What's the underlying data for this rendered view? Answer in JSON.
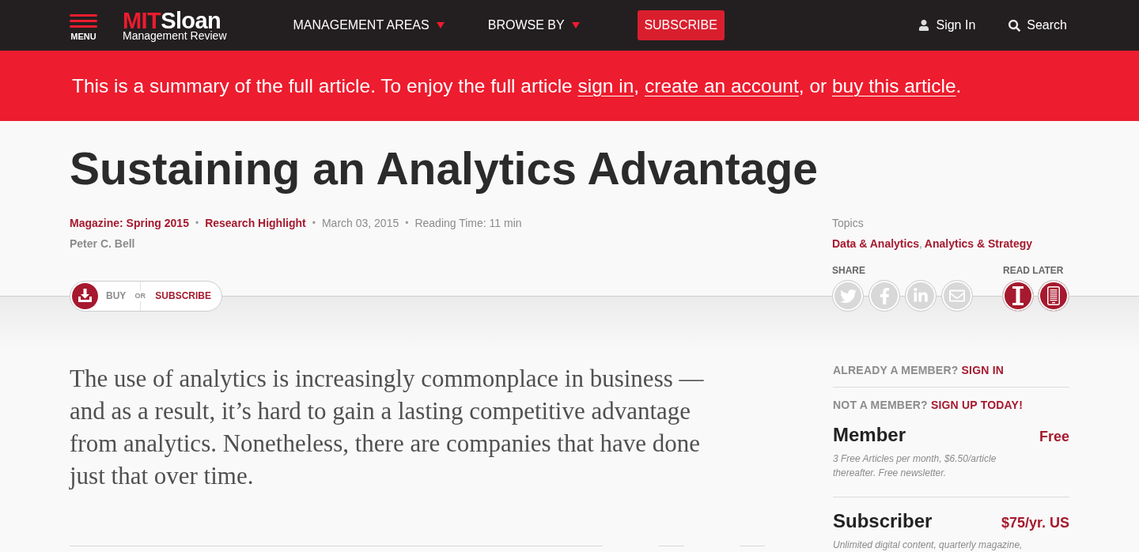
{
  "header": {
    "menu_label": "MENU",
    "logo": {
      "accent": "MIT",
      "name": "Sloan",
      "subtitle": "Management Review"
    },
    "nav_items": [
      {
        "label": "MANAGEMENT AREAS",
        "kind": "dropdown"
      },
      {
        "label": "BROWSE BY",
        "kind": "dropdown"
      },
      {
        "label": "SUBSCRIBE",
        "kind": "button"
      }
    ],
    "actions": [
      {
        "label": "Sign In",
        "kind": "account"
      },
      {
        "label": "Search",
        "kind": "search"
      }
    ]
  },
  "notice": {
    "segments": [
      {
        "text": "This is a summary of the full article. To enjoy the full article ",
        "kind": "text"
      },
      {
        "text": "sign in",
        "kind": "link"
      },
      {
        "text": ", ",
        "kind": "text"
      },
      {
        "text": "create an account",
        "kind": "link"
      },
      {
        "text": ", or ",
        "kind": "text"
      },
      {
        "text": "buy this article",
        "kind": "link"
      },
      {
        "text": ".",
        "kind": "text"
      }
    ]
  },
  "article": {
    "title": "Sustaining an Analytics Advantage",
    "meta": [
      {
        "text": "Magazine: Spring 2015",
        "kind": "link"
      },
      {
        "text": "Research Highlight",
        "kind": "link"
      },
      {
        "text": "March 03, 2015",
        "kind": "plain"
      },
      {
        "text": "Reading Time: 11 min",
        "kind": "plain"
      }
    ],
    "meta_separators": [
      "•",
      "•",
      "•"
    ],
    "author": "Peter C. Bell",
    "topics_label": "Topics",
    "topics": [
      "Data & Analytics",
      "Analytics & Strategy"
    ],
    "topics_separators": [
      ","
    ],
    "purchase": {
      "buy": "BUY",
      "or": "OR",
      "subscribe": "SUBSCRIBE"
    },
    "share_label": "SHARE",
    "read_later_label": "READ LATER",
    "lead": "The use of analytics is increasingly commonplace in business — and as a result, it’s hard to gain a lasting competitive advantage from analytics. Nonetheless, there are companies that have done just that over time."
  },
  "membership": {
    "member_prompt": {
      "text": "ALREADY A MEMBER?",
      "link": "SIGN IN"
    },
    "signup_prompt": {
      "text": "NOT A MEMBER?",
      "link": "SIGN UP TODAY!"
    },
    "plans": [
      {
        "name": "Member",
        "price": "Free",
        "description": "3 Free Articles per month, $6.50/article thereafter. Free newsletter."
      },
      {
        "name": "Subscriber",
        "price": "$75/yr. US",
        "description": "Unlimited digital content, quarterly magazine,"
      }
    ]
  }
}
